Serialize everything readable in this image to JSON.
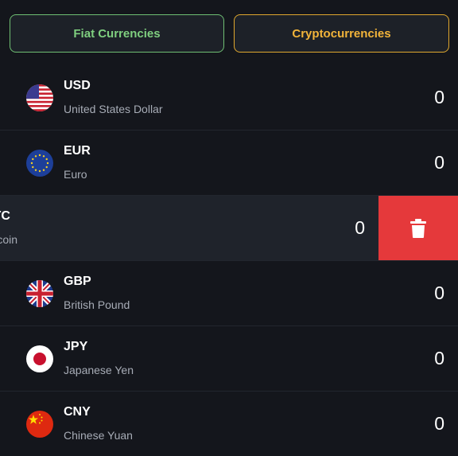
{
  "tabs": [
    {
      "label": "Fiat Currencies",
      "color": "#7fcf7f"
    },
    {
      "label": "Cryptocurrencies",
      "color": "#f2b43a"
    }
  ],
  "currencies": [
    {
      "code": "USD",
      "name": "United States Dollar",
      "amount": "0",
      "flag": "us-flag-icon"
    },
    {
      "code": "EUR",
      "name": "Euro",
      "amount": "0",
      "flag": "eu-flag-icon"
    },
    {
      "code": "BTC",
      "name": "Bitcoin",
      "amount": "0",
      "flag": "bitcoin-icon",
      "swiped": true
    },
    {
      "code": "GBP",
      "name": "British Pound",
      "amount": "0",
      "flag": "uk-flag-icon"
    },
    {
      "code": "JPY",
      "name": "Japanese Yen",
      "amount": "0",
      "flag": "jp-flag-icon"
    },
    {
      "code": "CNY",
      "name": "Chinese Yuan",
      "amount": "0",
      "flag": "cn-flag-icon"
    }
  ],
  "delete_action": {
    "icon": "trash-icon",
    "color": "#e5393b"
  }
}
